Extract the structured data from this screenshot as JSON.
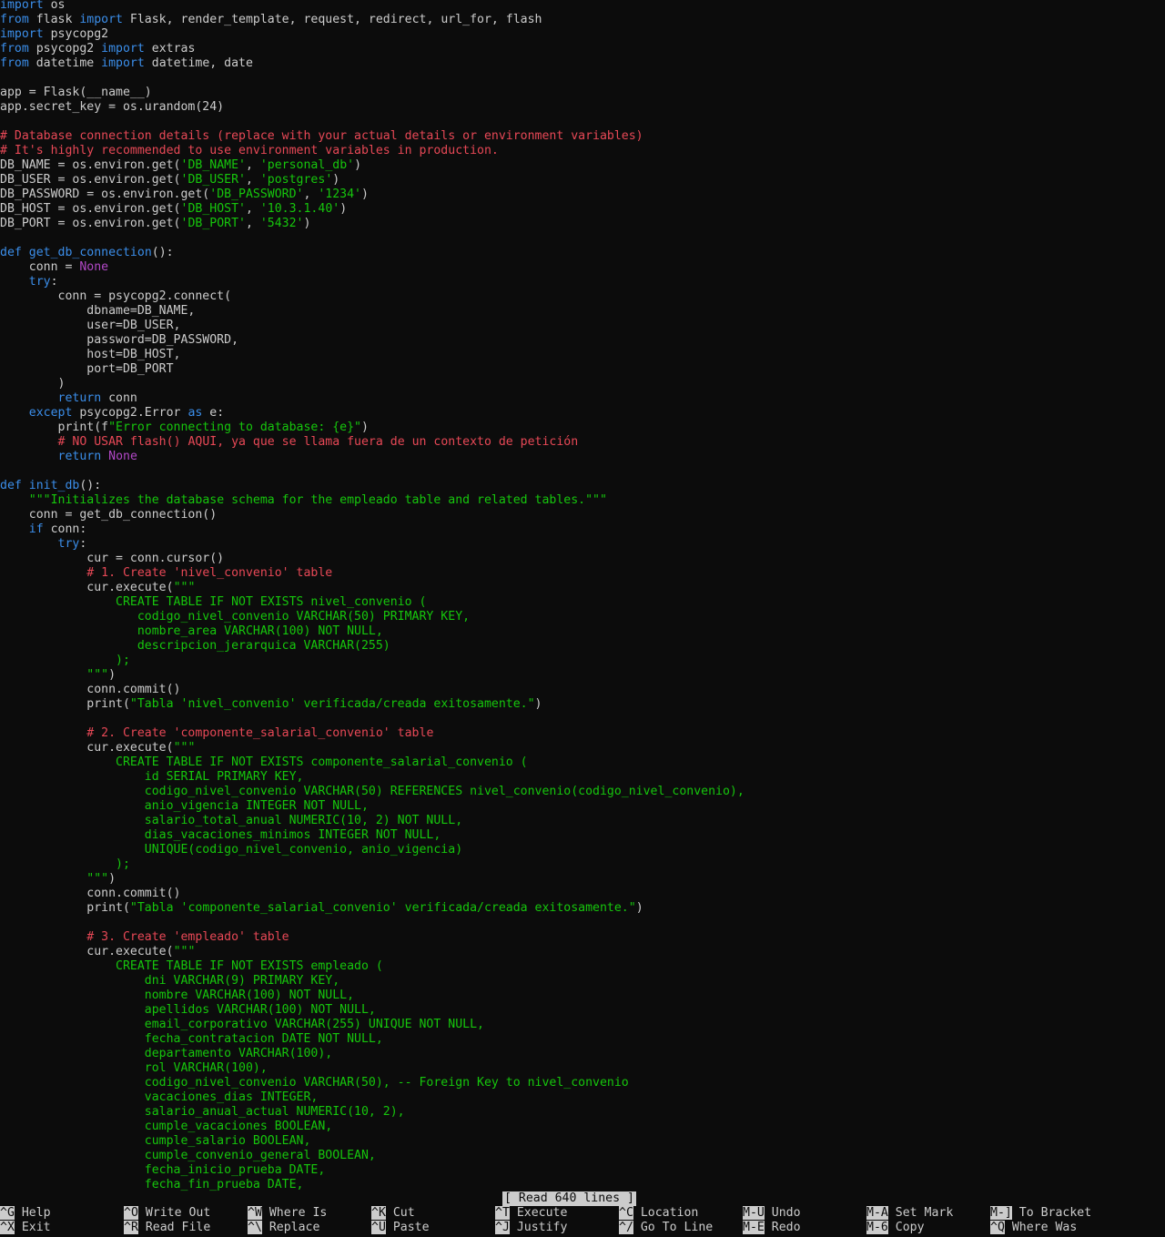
{
  "editor": {
    "lines": [
      [
        [
          "kw",
          "import"
        ],
        [
          "pl",
          " os"
        ]
      ],
      [
        [
          "kw",
          "from"
        ],
        [
          "pl",
          " flask "
        ],
        [
          "kw",
          "import"
        ],
        [
          "pl",
          " Flask, render_template, request, redirect, url_for, flash"
        ]
      ],
      [
        [
          "kw",
          "import"
        ],
        [
          "pl",
          " psycopg2"
        ]
      ],
      [
        [
          "kw",
          "from"
        ],
        [
          "pl",
          " psycopg2 "
        ],
        [
          "kw",
          "import"
        ],
        [
          "pl",
          " extras"
        ]
      ],
      [
        [
          "kw",
          "from"
        ],
        [
          "pl",
          " datetime "
        ],
        [
          "kw",
          "import"
        ],
        [
          "pl",
          " datetime, date"
        ]
      ],
      [],
      [
        [
          "pl",
          "app = Flask(__name__)"
        ]
      ],
      [
        [
          "pl",
          "app.secret_key = os.urandom(24)"
        ]
      ],
      [],
      [
        [
          "cm",
          "# Database connection details (replace with your actual details or environment variables)"
        ]
      ],
      [
        [
          "cm",
          "# It's highly recommended to use environment variables in production."
        ]
      ],
      [
        [
          "pl",
          "DB_NAME = os.environ.get("
        ],
        [
          "st",
          "'DB_NAME'"
        ],
        [
          "pl",
          ", "
        ],
        [
          "st",
          "'personal_db'"
        ],
        [
          "pl",
          ")"
        ]
      ],
      [
        [
          "pl",
          "DB_USER = os.environ.get("
        ],
        [
          "st",
          "'DB_USER'"
        ],
        [
          "pl",
          ", "
        ],
        [
          "st",
          "'postgres'"
        ],
        [
          "pl",
          ")"
        ]
      ],
      [
        [
          "pl",
          "DB_PASSWORD = os.environ.get("
        ],
        [
          "st",
          "'DB_PASSWORD'"
        ],
        [
          "pl",
          ", "
        ],
        [
          "st",
          "'1234'"
        ],
        [
          "pl",
          ")"
        ]
      ],
      [
        [
          "pl",
          "DB_HOST = os.environ.get("
        ],
        [
          "st",
          "'DB_HOST'"
        ],
        [
          "pl",
          ", "
        ],
        [
          "st",
          "'10.3.1.40'"
        ],
        [
          "pl",
          ")"
        ]
      ],
      [
        [
          "pl",
          "DB_PORT = os.environ.get("
        ],
        [
          "st",
          "'DB_PORT'"
        ],
        [
          "pl",
          ", "
        ],
        [
          "st",
          "'5432'"
        ],
        [
          "pl",
          ")"
        ]
      ],
      [],
      [
        [
          "kw",
          "def"
        ],
        [
          "pl",
          " "
        ],
        [
          "fn",
          "get_db_connection"
        ],
        [
          "pl",
          "():"
        ]
      ],
      [
        [
          "pl",
          "    conn = "
        ],
        [
          "nu",
          "None"
        ]
      ],
      [
        [
          "pl",
          "    "
        ],
        [
          "kw",
          "try"
        ],
        [
          "pl",
          ":"
        ]
      ],
      [
        [
          "pl",
          "        conn = psycopg2.connect("
        ]
      ],
      [
        [
          "pl",
          "            dbname=DB_NAME,"
        ]
      ],
      [
        [
          "pl",
          "            user=DB_USER,"
        ]
      ],
      [
        [
          "pl",
          "            password=DB_PASSWORD,"
        ]
      ],
      [
        [
          "pl",
          "            host=DB_HOST,"
        ]
      ],
      [
        [
          "pl",
          "            port=DB_PORT"
        ]
      ],
      [
        [
          "pl",
          "        )"
        ]
      ],
      [
        [
          "pl",
          "        "
        ],
        [
          "kw",
          "return"
        ],
        [
          "pl",
          " conn"
        ]
      ],
      [
        [
          "pl",
          "    "
        ],
        [
          "kw",
          "except"
        ],
        [
          "pl",
          " psycopg2.Error "
        ],
        [
          "kw",
          "as"
        ],
        [
          "pl",
          " e:"
        ]
      ],
      [
        [
          "pl",
          "        print(f"
        ],
        [
          "st",
          "\"Error connecting to database: {e}\""
        ],
        [
          "pl",
          ")"
        ]
      ],
      [
        [
          "pl",
          "        "
        ],
        [
          "cm",
          "# NO USAR flash() AQUÍ, ya que se llama fuera de un contexto de petición"
        ]
      ],
      [
        [
          "pl",
          "        "
        ],
        [
          "kw",
          "return"
        ],
        [
          "pl",
          " "
        ],
        [
          "nu",
          "None"
        ]
      ],
      [],
      [
        [
          "kw",
          "def"
        ],
        [
          "pl",
          " "
        ],
        [
          "fn",
          "init_db"
        ],
        [
          "pl",
          "():"
        ]
      ],
      [
        [
          "pl",
          "    "
        ],
        [
          "st",
          "\"\"\"Initializes the database schema for the empleado table and related tables.\"\"\""
        ]
      ],
      [
        [
          "pl",
          "    conn = get_db_connection()"
        ]
      ],
      [
        [
          "pl",
          "    "
        ],
        [
          "kw",
          "if"
        ],
        [
          "pl",
          " conn:"
        ]
      ],
      [
        [
          "pl",
          "        "
        ],
        [
          "kw",
          "try"
        ],
        [
          "pl",
          ":"
        ]
      ],
      [
        [
          "pl",
          "            cur = conn.cursor()"
        ]
      ],
      [
        [
          "pl",
          "            "
        ],
        [
          "cm",
          "# 1. Create 'nivel_convenio' table"
        ]
      ],
      [
        [
          "pl",
          "            cur.execute("
        ],
        [
          "st",
          "\"\"\""
        ]
      ],
      [
        [
          "st",
          "                CREATE TABLE IF NOT EXISTS nivel_convenio ("
        ]
      ],
      [
        [
          "st",
          "                   codigo_nivel_convenio VARCHAR(50) PRIMARY KEY,"
        ]
      ],
      [
        [
          "st",
          "                   nombre_area VARCHAR(100) NOT NULL,"
        ]
      ],
      [
        [
          "st",
          "                   descripcion_jerarquica VARCHAR(255)"
        ]
      ],
      [
        [
          "st",
          "                );"
        ]
      ],
      [
        [
          "st",
          "            \"\"\""
        ],
        [
          "pl",
          ")"
        ]
      ],
      [
        [
          "pl",
          "            conn.commit()"
        ]
      ],
      [
        [
          "pl",
          "            print("
        ],
        [
          "st",
          "\"Tabla 'nivel_convenio' verificada/creada exitosamente.\""
        ],
        [
          "pl",
          ")"
        ]
      ],
      [],
      [
        [
          "pl",
          "            "
        ],
        [
          "cm",
          "# 2. Create 'componente_salarial_convenio' table"
        ]
      ],
      [
        [
          "pl",
          "            cur.execute("
        ],
        [
          "st",
          "\"\"\""
        ]
      ],
      [
        [
          "st",
          "                CREATE TABLE IF NOT EXISTS componente_salarial_convenio ("
        ]
      ],
      [
        [
          "st",
          "                    id SERIAL PRIMARY KEY,"
        ]
      ],
      [
        [
          "st",
          "                    codigo_nivel_convenio VARCHAR(50) REFERENCES nivel_convenio(codigo_nivel_convenio),"
        ]
      ],
      [
        [
          "st",
          "                    anio_vigencia INTEGER NOT NULL,"
        ]
      ],
      [
        [
          "st",
          "                    salario_total_anual NUMERIC(10, 2) NOT NULL,"
        ]
      ],
      [
        [
          "st",
          "                    dias_vacaciones_minimos INTEGER NOT NULL,"
        ]
      ],
      [
        [
          "st",
          "                    UNIQUE(codigo_nivel_convenio, anio_vigencia)"
        ]
      ],
      [
        [
          "st",
          "                );"
        ]
      ],
      [
        [
          "st",
          "            \"\"\""
        ],
        [
          "pl",
          ")"
        ]
      ],
      [
        [
          "pl",
          "            conn.commit()"
        ]
      ],
      [
        [
          "pl",
          "            print("
        ],
        [
          "st",
          "\"Tabla 'componente_salarial_convenio' verificada/creada exitosamente.\""
        ],
        [
          "pl",
          ")"
        ]
      ],
      [],
      [
        [
          "pl",
          "            "
        ],
        [
          "cm",
          "# 3. Create 'empleado' table"
        ]
      ],
      [
        [
          "pl",
          "            cur.execute("
        ],
        [
          "st",
          "\"\"\""
        ]
      ],
      [
        [
          "st",
          "                CREATE TABLE IF NOT EXISTS empleado ("
        ]
      ],
      [
        [
          "st",
          "                    dni VARCHAR(9) PRIMARY KEY,"
        ]
      ],
      [
        [
          "st",
          "                    nombre VARCHAR(100) NOT NULL,"
        ]
      ],
      [
        [
          "st",
          "                    apellidos VARCHAR(100) NOT NULL,"
        ]
      ],
      [
        [
          "st",
          "                    email_corporativo VARCHAR(255) UNIQUE NOT NULL,"
        ]
      ],
      [
        [
          "st",
          "                    fecha_contratacion DATE NOT NULL,"
        ]
      ],
      [
        [
          "st",
          "                    departamento VARCHAR(100),"
        ]
      ],
      [
        [
          "st",
          "                    rol VARCHAR(100),"
        ]
      ],
      [
        [
          "st",
          "                    codigo_nivel_convenio VARCHAR(50), -- Foreign Key to nivel_convenio"
        ]
      ],
      [
        [
          "st",
          "                    vacaciones_dias INTEGER,"
        ]
      ],
      [
        [
          "st",
          "                    salario_anual_actual NUMERIC(10, 2),"
        ]
      ],
      [
        [
          "st",
          "                    cumple_vacaciones BOOLEAN,"
        ]
      ],
      [
        [
          "st",
          "                    cumple_salario BOOLEAN,"
        ]
      ],
      [
        [
          "st",
          "                    cumple_convenio_general BOOLEAN,"
        ]
      ],
      [
        [
          "st",
          "                    fecha_inicio_prueba DATE,"
        ]
      ],
      [
        [
          "st",
          "                    fecha_fin_prueba DATE,"
        ]
      ]
    ]
  },
  "status": {
    "message": "[ Read 640 lines ]"
  },
  "shortcuts": [
    {
      "key": "^G",
      "label": "Help"
    },
    {
      "key": "^X",
      "label": "Exit"
    },
    {
      "key": "^O",
      "label": "Write Out"
    },
    {
      "key": "^R",
      "label": "Read File"
    },
    {
      "key": "^W",
      "label": "Where Is"
    },
    {
      "key": "^\\",
      "label": "Replace"
    },
    {
      "key": "^K",
      "label": "Cut"
    },
    {
      "key": "^U",
      "label": "Paste"
    },
    {
      "key": "^T",
      "label": "Execute"
    },
    {
      "key": "^J",
      "label": "Justify"
    },
    {
      "key": "^C",
      "label": "Location"
    },
    {
      "key": "^/",
      "label": "Go To Line"
    },
    {
      "key": "M-U",
      "label": "Undo"
    },
    {
      "key": "M-E",
      "label": "Redo"
    },
    {
      "key": "M-A",
      "label": "Set Mark"
    },
    {
      "key": "M-6",
      "label": "Copy"
    },
    {
      "key": "M-]",
      "label": "To Bracket"
    },
    {
      "key": "^Q",
      "label": "Where Was"
    }
  ],
  "colors": {
    "background": "#0c0c0c",
    "text": "#cccccc",
    "keyword": "#3b8eea",
    "comment": "#e74856",
    "string": "#16c60c",
    "constant": "#b148c6"
  }
}
